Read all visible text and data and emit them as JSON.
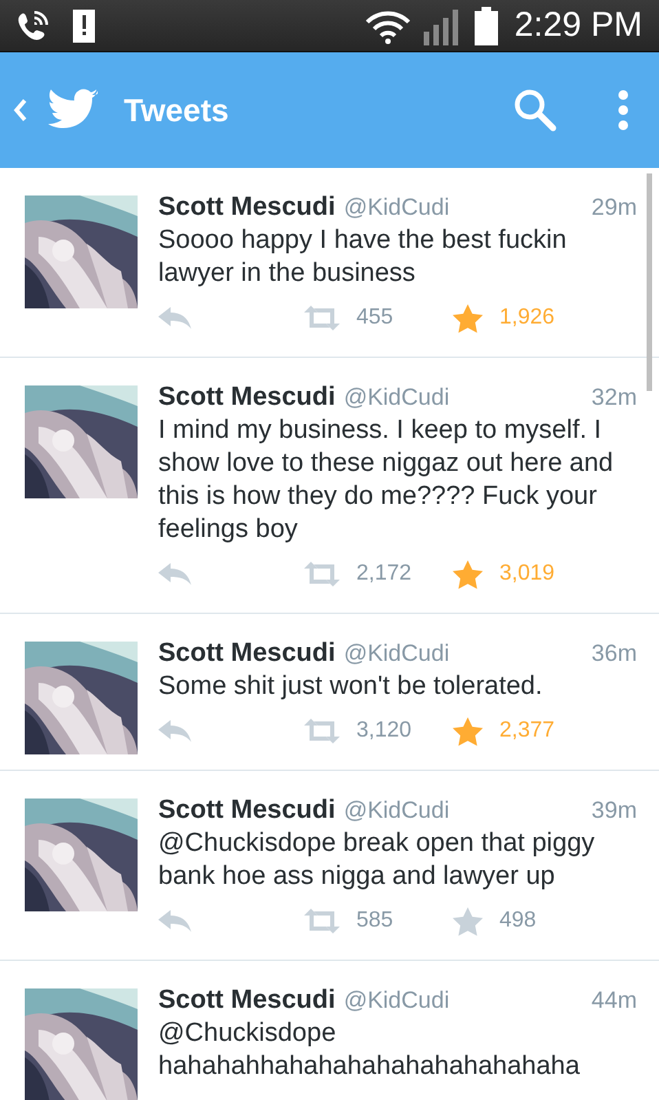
{
  "status_bar": {
    "time": "2:29 PM"
  },
  "app_bar": {
    "title": "Tweets"
  },
  "tweets": [
    {
      "name": "Scott Mescudi",
      "handle": "@KidCudi",
      "time": "29m",
      "text": "Soooo happy I have the best fuckin lawyer in the business",
      "retweets": "455",
      "favorites": "1,926",
      "favorited": true
    },
    {
      "name": "Scott Mescudi",
      "handle": "@KidCudi",
      "time": "32m",
      "text": "I mind my business. I keep to myself. I show love to these niggaz out here and this is how they do me???? Fuck your feelings boy",
      "retweets": "2,172",
      "favorites": "3,019",
      "favorited": true
    },
    {
      "name": "Scott Mescudi",
      "handle": "@KidCudi",
      "time": "36m",
      "text": "Some shit just won't be tolerated.",
      "retweets": "3,120",
      "favorites": "2,377",
      "favorited": true
    },
    {
      "name": "Scott Mescudi",
      "handle": "@KidCudi",
      "time": "39m",
      "text": "@Chuckisdope break open that piggy bank hoe ass nigga and lawyer up",
      "retweets": "585",
      "favorites": "498",
      "favorited": false
    },
    {
      "name": "Scott Mescudi",
      "handle": "@KidCudi",
      "time": "44m",
      "text": "@Chuckisdope hahahahhahahahahahahahahahaha"
    }
  ]
}
